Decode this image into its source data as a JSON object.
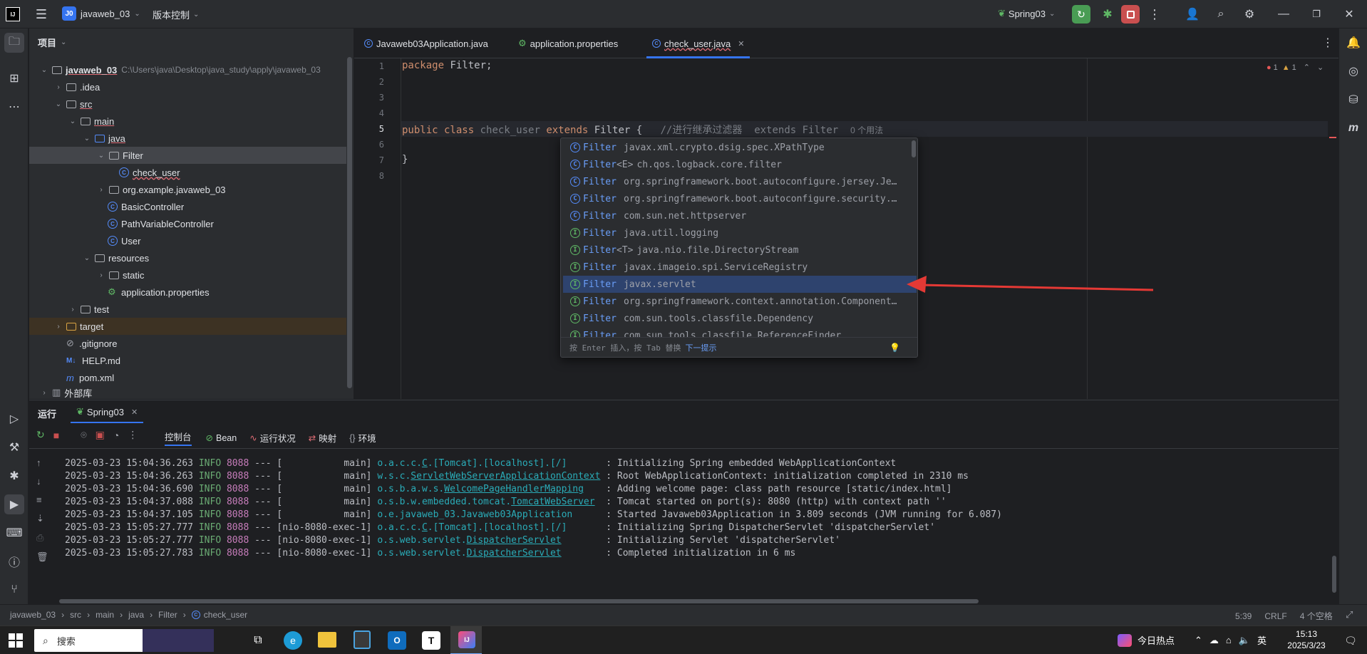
{
  "titlebar": {
    "project_badge": "J0",
    "project_name": "javaweb_03",
    "vcs_label": "版本控制",
    "run_config": "Spring03"
  },
  "project_panel": {
    "title": "项目",
    "tree": [
      {
        "label": "javaweb_03",
        "extra": "C:\\Users\\java\\Desktop\\java_study\\apply\\javaweb_03"
      },
      {
        "label": ".idea"
      },
      {
        "label": "src"
      },
      {
        "label": "main"
      },
      {
        "label": "java"
      },
      {
        "label": "Filter"
      },
      {
        "label": "check_user"
      },
      {
        "label": "org.example.javaweb_03"
      },
      {
        "label": "BasicController"
      },
      {
        "label": "PathVariableController"
      },
      {
        "label": "User"
      },
      {
        "label": "resources"
      },
      {
        "label": "static"
      },
      {
        "label": "application.properties"
      },
      {
        "label": "test"
      },
      {
        "label": "target"
      },
      {
        "label": ".gitignore"
      },
      {
        "label": "HELP.md"
      },
      {
        "label": "pom.xml"
      },
      {
        "label": "外部库"
      }
    ]
  },
  "editor": {
    "tabs": [
      {
        "label": "Javaweb03Application.java"
      },
      {
        "label": "application.properties"
      },
      {
        "label": "check_user.java"
      }
    ],
    "line_numbers": [
      "1",
      "2",
      "3",
      "4",
      "5",
      "6",
      "7",
      "8"
    ],
    "code": {
      "l1_kw": "package",
      "l1_rest": " Filter;",
      "l5_kw1": "public class",
      "l5_name": " check_user ",
      "l5_kw2": "extends",
      "l5_rest": " Filter {",
      "l5_comment": "   //进行继承过滤器  extends Filter",
      "l5_hint": "0 个用法",
      "l7": "}"
    },
    "inspection": {
      "errors": "1",
      "warnings": "1"
    }
  },
  "autocomplete": {
    "items": [
      {
        "kind": "c",
        "name": "Filter",
        "generic": "",
        "pkg": "javax.xml.crypto.dsig.spec.XPathType"
      },
      {
        "kind": "c",
        "name": "Filter",
        "generic": "<E>",
        "pkg": "ch.qos.logback.core.filter"
      },
      {
        "kind": "c",
        "name": "Filter",
        "generic": "",
        "pkg": "org.springframework.boot.autoconfigure.jersey.Je…"
      },
      {
        "kind": "c",
        "name": "Filter",
        "generic": "",
        "pkg": "org.springframework.boot.autoconfigure.security.…"
      },
      {
        "kind": "c",
        "name": "Filter",
        "generic": "",
        "pkg": "com.sun.net.httpserver"
      },
      {
        "kind": "i",
        "name": "Filter",
        "generic": "",
        "pkg": "java.util.logging"
      },
      {
        "kind": "i",
        "name": "Filter",
        "generic": "<T>",
        "pkg": "java.nio.file.DirectoryStream"
      },
      {
        "kind": "i",
        "name": "Filter",
        "generic": "",
        "pkg": "javax.imageio.spi.ServiceRegistry"
      },
      {
        "kind": "i",
        "name": "Filter",
        "generic": "",
        "pkg": "javax.servlet",
        "selected": true
      },
      {
        "kind": "i",
        "name": "Filter",
        "generic": "",
        "pkg": "org.springframework.context.annotation.Component…"
      },
      {
        "kind": "i",
        "name": "Filter",
        "generic": "",
        "pkg": "com.sun.tools.classfile.Dependency"
      },
      {
        "kind": "i",
        "name": "Filter",
        "generic": "",
        "pkg": "com.sun.tools.classfile.ReferenceFinder"
      }
    ],
    "footer_hint": "按 Enter 插入，按 Tab 替换",
    "footer_link": "下一提示"
  },
  "run_panel": {
    "title": "运行",
    "tab": "Spring03",
    "subtabs": [
      "控制台",
      "Bean",
      "运行状况",
      "映射",
      "环境"
    ],
    "logs": [
      {
        "ts": "2025-03-23 15:04:36.263",
        "lvl": "INFO",
        "pid": "8088",
        "sep": " --- [",
        "thread": "           main]",
        "cls_pre": " o.a.c.c.",
        "cls_ul": "C",
        "cls_post": ".[Tomcat].[localhost].[/]",
        "pad": "       ",
        "msg": ": Initializing Spring embedded WebApplicationContext"
      },
      {
        "ts": "2025-03-23 15:04:36.263",
        "lvl": "INFO",
        "pid": "8088",
        "sep": " --- [",
        "thread": "           main]",
        "cls_pre": " w.s.c.",
        "cls_ul": "ServletWebServerApplicationContext",
        "cls_post": "",
        "pad": " ",
        "msg": ": Root WebApplicationContext: initialization completed in 2310 ms"
      },
      {
        "ts": "2025-03-23 15:04:36.690",
        "lvl": "INFO",
        "pid": "8088",
        "sep": " --- [",
        "thread": "           main]",
        "cls_pre": " o.s.b.a.w.s.",
        "cls_ul": "WelcomePageHandlerMapping",
        "cls_post": "",
        "pad": "    ",
        "msg": ": Adding welcome page: class path resource [static/index.html]"
      },
      {
        "ts": "2025-03-23 15:04:37.088",
        "lvl": "INFO",
        "pid": "8088",
        "sep": " --- [",
        "thread": "           main]",
        "cls_pre": " o.s.b.w.embedded.tomcat.",
        "cls_ul": "TomcatWebServer",
        "cls_post": "",
        "pad": "  ",
        "msg": ": Tomcat started on port(s): 8080 (http) with context path ''"
      },
      {
        "ts": "2025-03-23 15:04:37.105",
        "lvl": "INFO",
        "pid": "8088",
        "sep": " --- [",
        "thread": "           main]",
        "cls_pre": " o.e.javaweb_03.Javaweb03Application",
        "cls_ul": "",
        "cls_post": "",
        "pad": "      ",
        "msg": ": Started Javaweb03Application in 3.809 seconds (JVM running for 6.087)"
      },
      {
        "ts": "2025-03-23 15:05:27.777",
        "lvl": "INFO",
        "pid": "8088",
        "sep": " --- [",
        "thread": "nio-8080-exec-1]",
        "cls_pre": " o.a.c.c.",
        "cls_ul": "C",
        "cls_post": ".[Tomcat].[localhost].[/]",
        "pad": "       ",
        "msg": ": Initializing Spring DispatcherServlet 'dispatcherServlet'"
      },
      {
        "ts": "2025-03-23 15:05:27.777",
        "lvl": "INFO",
        "pid": "8088",
        "sep": " --- [",
        "thread": "nio-8080-exec-1]",
        "cls_pre": " o.s.web.servlet.",
        "cls_ul": "DispatcherServlet",
        "cls_post": "",
        "pad": "        ",
        "msg": ": Initializing Servlet 'dispatcherServlet'"
      },
      {
        "ts": "2025-03-23 15:05:27.783",
        "lvl": "INFO",
        "pid": "8088",
        "sep": " --- [",
        "thread": "nio-8080-exec-1]",
        "cls_pre": " o.s.web.servlet.",
        "cls_ul": "DispatcherServlet",
        "cls_post": "",
        "pad": "        ",
        "msg": ": Completed initialization in 6 ms"
      }
    ]
  },
  "statusbar": {
    "breadcrumb": [
      "javaweb_03",
      "src",
      "main",
      "java",
      "Filter",
      "check_user"
    ],
    "position": "5:39",
    "line_ending": "CRLF",
    "indent": "4 个空格"
  },
  "taskbar": {
    "search": "搜索",
    "news": "今日热点",
    "ime": "英",
    "time": "15:13",
    "date": "2025/3/23"
  },
  "colors": {
    "accent": "#3574f0",
    "run_green": "#499c54",
    "stop_red": "#c94f4f",
    "annotation_arrow": "#e53935"
  }
}
